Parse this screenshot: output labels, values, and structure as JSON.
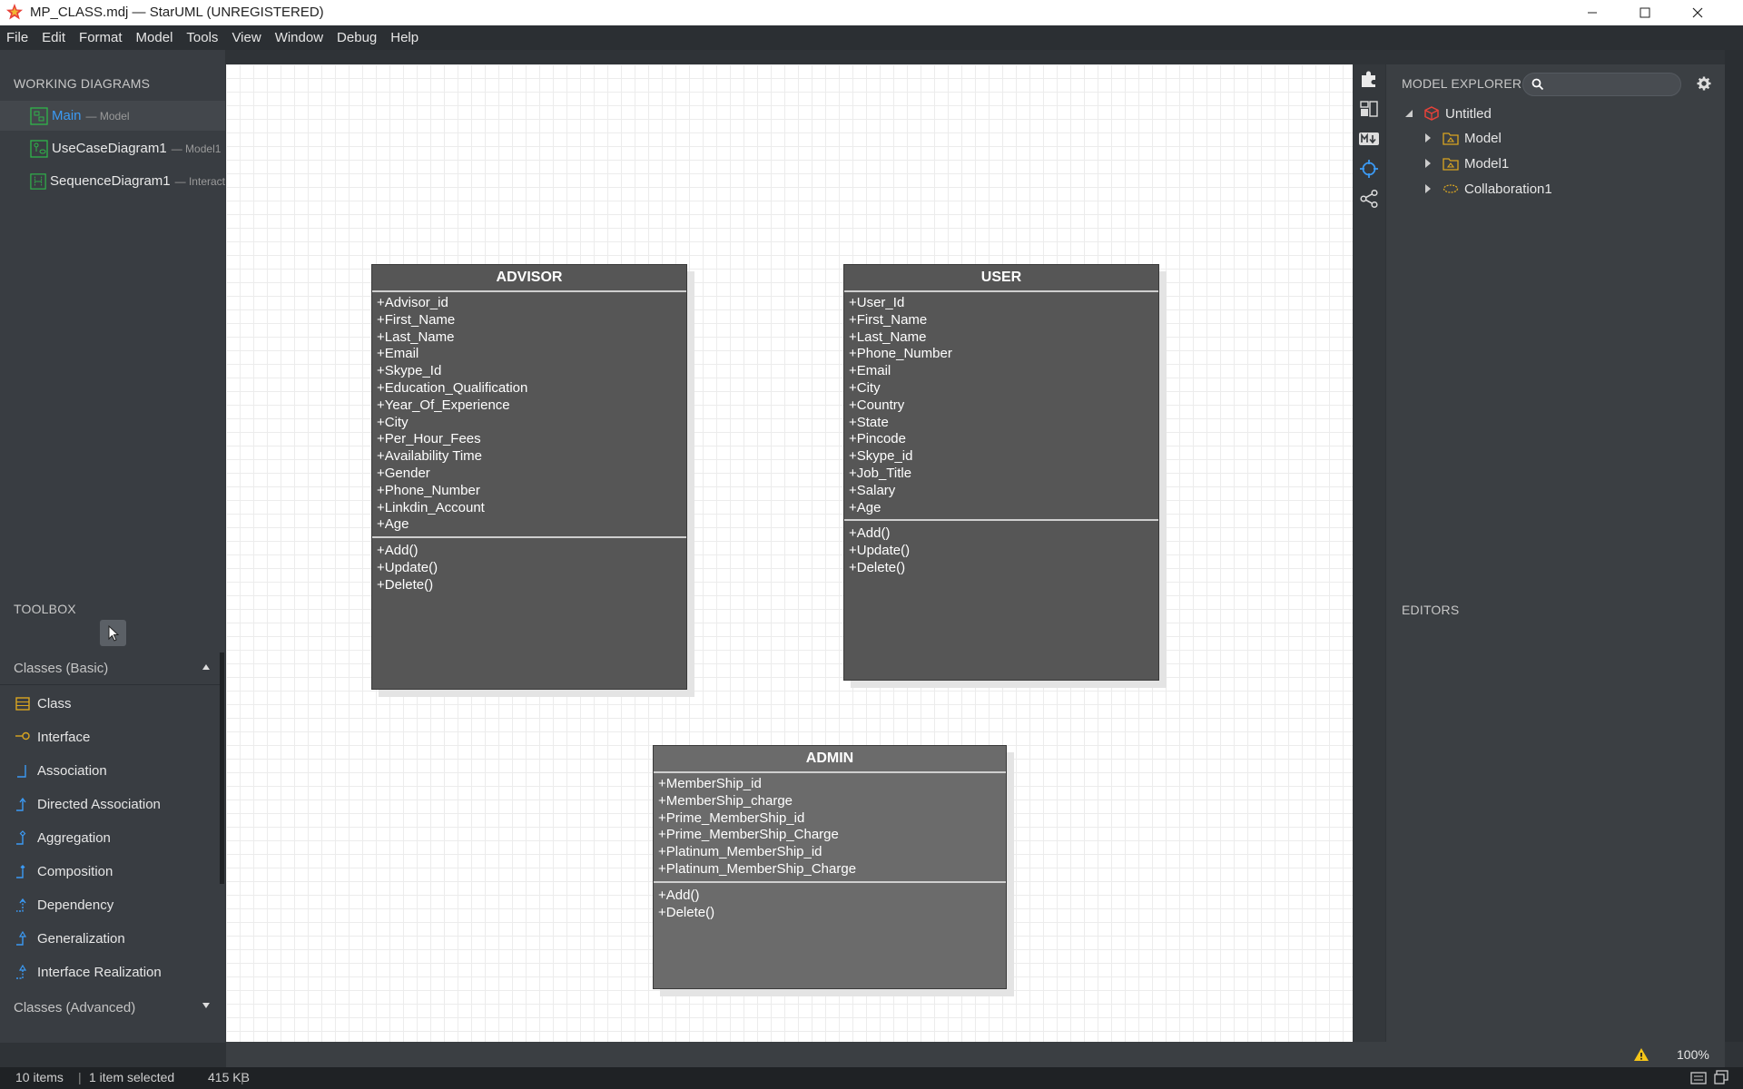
{
  "window": {
    "title": "MP_CLASS.mdj — StarUML (UNREGISTERED)"
  },
  "menu": [
    "File",
    "Edit",
    "Format",
    "Model",
    "Tools",
    "View",
    "Window",
    "Debug",
    "Help"
  ],
  "working_diagrams": {
    "title": "WORKING DIAGRAMS",
    "items": [
      {
        "name": "Main",
        "sub": "— Model",
        "icon": "class-diagram-icon",
        "selected": true
      },
      {
        "name": "UseCaseDiagram1",
        "sub": "— Model1",
        "icon": "usecase-diagram-icon"
      },
      {
        "name": "SequenceDiagram1",
        "sub": "— Interact",
        "icon": "sequence-diagram-icon"
      }
    ]
  },
  "toolbox": {
    "title": "TOOLBOX",
    "section_basic": "Classes (Basic)",
    "items": [
      "Class",
      "Interface",
      "Association",
      "Directed Association",
      "Aggregation",
      "Composition",
      "Dependency",
      "Generalization",
      "Interface Realization"
    ],
    "section_advanced": "Classes (Advanced)"
  },
  "diagram": {
    "classes": [
      {
        "name": "ADVISOR",
        "attributes": [
          "+Advisor_id",
          "+First_Name",
          "+Last_Name",
          "+Email",
          "+Skype_Id",
          "+Education_Qualification",
          "+Year_Of_Experience",
          "+City",
          "+Per_Hour_Fees",
          "+Availability Time",
          "+Gender",
          "+Phone_Number",
          "+Linkdin_Account",
          "+Age"
        ],
        "operations": [
          "+Add()",
          "+Update()",
          "+Delete()"
        ]
      },
      {
        "name": "USER",
        "attributes": [
          "+User_Id",
          "+First_Name",
          "+Last_Name",
          "+Phone_Number",
          "+Email",
          "+City",
          "+Country",
          "+State",
          "+Pincode",
          "+Skype_id",
          "+Job_Title",
          "+Salary",
          "+Age"
        ],
        "operations": [
          "+Add()",
          "+Update()",
          "+Delete()"
        ]
      },
      {
        "name": "ADMIN",
        "attributes": [
          "+MemberShip_id",
          "+MemberShip_charge",
          "+Prime_MemberShip_id",
          "+Prime_MemberShip_Charge",
          "+Platinum_MemberShip_id",
          "+Platinum_MemberShip_Charge"
        ],
        "operations": [
          "+Add()",
          "+Delete()"
        ]
      }
    ]
  },
  "model_explorer": {
    "title": "MODEL EXPLORER",
    "search_value": "",
    "tree": [
      {
        "label": "Untitled",
        "icon": "project-icon",
        "expanded": true
      },
      {
        "label": "Model",
        "icon": "model-icon",
        "expanded": false
      },
      {
        "label": "Model1",
        "icon": "model-icon",
        "expanded": false
      },
      {
        "label": "Collaboration1",
        "icon": "collaboration-icon",
        "expanded": false
      }
    ]
  },
  "editors": {
    "title": "EDITORS"
  },
  "status": {
    "items": "10 items",
    "selection": "1 item selected",
    "size": "415 KB",
    "zoom": "100%"
  },
  "colors": {
    "accent": "#3b9af4",
    "class_fill": "#565656",
    "admin_fill": "#6b6b6b",
    "warning": "#f5c518"
  }
}
